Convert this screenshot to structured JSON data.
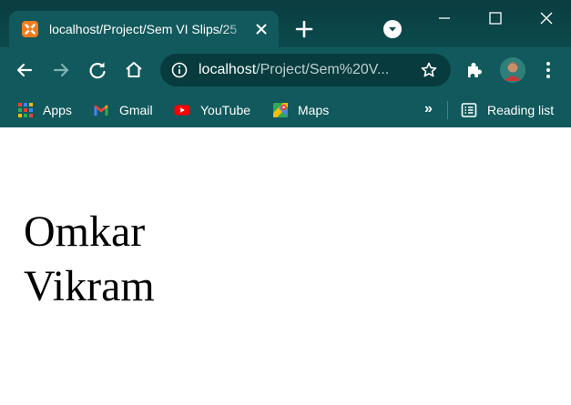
{
  "browser": {
    "tab": {
      "title": "localhost/Project/Sem VI Slips/25",
      "favicon": "xampp-icon"
    },
    "address_bar": {
      "host": "localhost",
      "path": "/Project/Sem%20V..."
    },
    "colors": {
      "frame": "#0c4f52",
      "toolbar": "#11595c",
      "omnibox": "#073b3d",
      "favicon": "#f27c1c"
    },
    "bookmarks": [
      {
        "label": "Apps",
        "icon": "apps-grid-icon"
      },
      {
        "label": "Gmail",
        "icon": "gmail-icon"
      },
      {
        "label": "YouTube",
        "icon": "youtube-icon"
      },
      {
        "label": "Maps",
        "icon": "maps-icon"
      }
    ],
    "more_bookmarks": "»",
    "reading_list": {
      "label": "Reading list",
      "icon": "reading-list-icon"
    }
  },
  "page": {
    "lines": [
      "Omkar",
      "Vikram"
    ]
  }
}
